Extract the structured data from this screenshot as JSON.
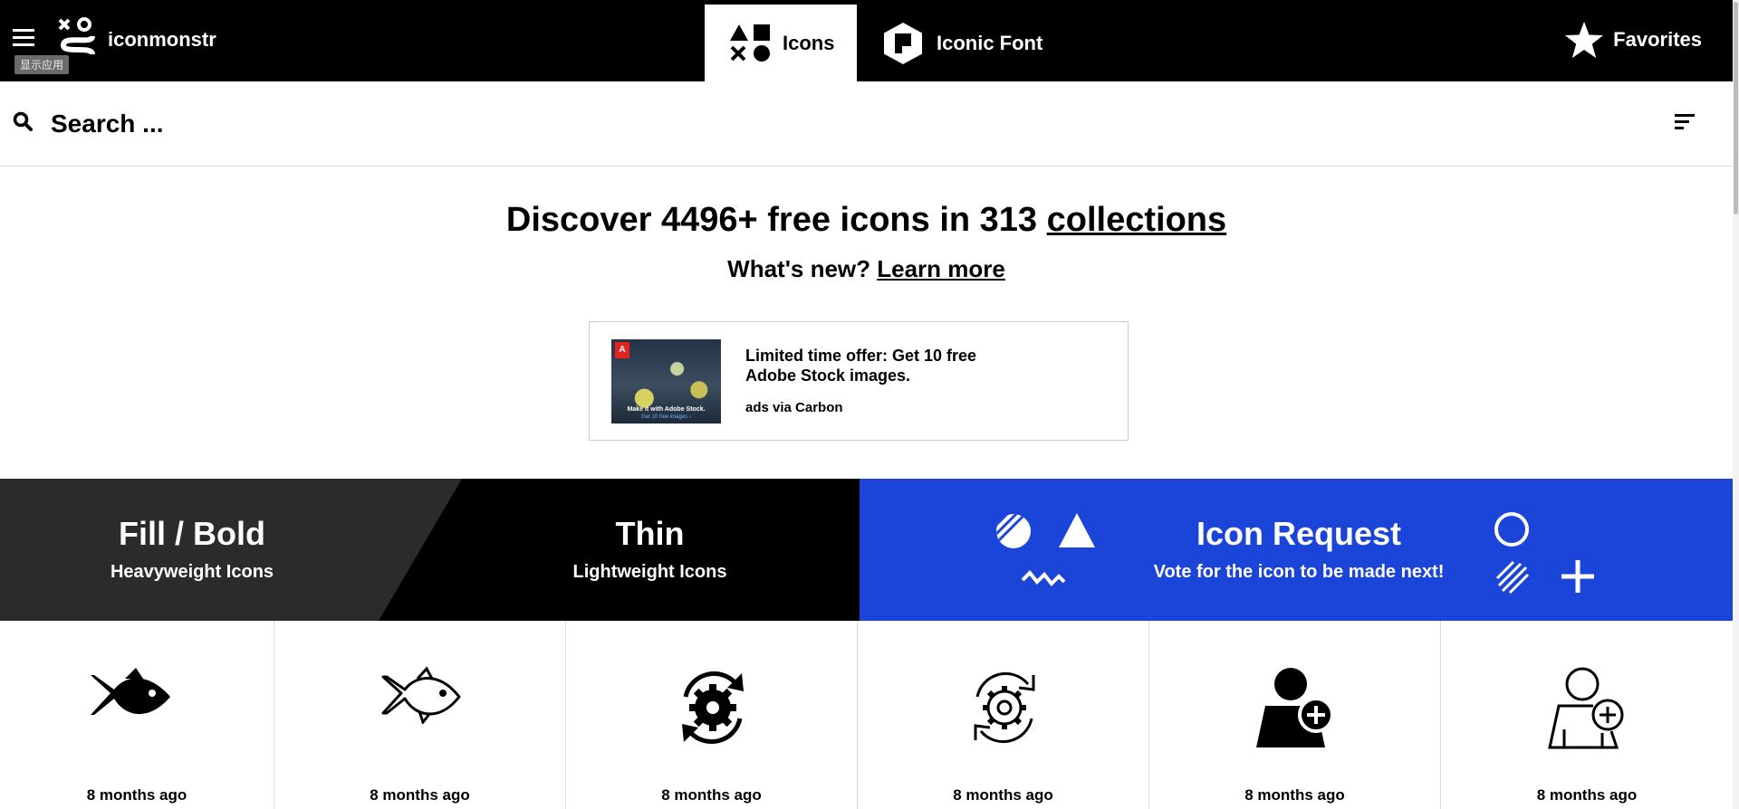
{
  "header": {
    "brand": "iconmonstr",
    "tooltip": "显示应用",
    "tabs": [
      {
        "label": "Icons",
        "active": true
      },
      {
        "label": "Iconic Font",
        "active": false
      }
    ],
    "favorites_label": "Favorites"
  },
  "search": {
    "placeholder": "Search ..."
  },
  "hero": {
    "title_prefix": "Discover 4496+ free icons in 313 ",
    "title_link": "collections",
    "sub_prefix": "What's new? ",
    "sub_link": "Learn more"
  },
  "ad": {
    "image_caption": "Make it with Adobe Stock.",
    "image_cta": "Get 10 free images ›",
    "text": "Limited time offer: Get 10 free Adobe Stock images.",
    "via": "ads via Carbon"
  },
  "banners": {
    "fill": {
      "title": "Fill / Bold",
      "subtitle": "Heavyweight Icons"
    },
    "thin": {
      "title": "Thin",
      "subtitle": "Lightweight Icons"
    },
    "request": {
      "title": "Icon Request",
      "subtitle": "Vote for the icon to be made next!"
    }
  },
  "icons": [
    {
      "icon": "fish-filled-icon",
      "date": "8 months ago"
    },
    {
      "icon": "fish-thin-icon",
      "date": "8 months ago"
    },
    {
      "icon": "gear-sync-filled-icon",
      "date": "8 months ago"
    },
    {
      "icon": "gear-sync-thin-icon",
      "date": "8 months ago"
    },
    {
      "icon": "user-add-filled-icon",
      "date": "8 months ago"
    },
    {
      "icon": "user-add-thin-icon",
      "date": "8 months ago"
    }
  ],
  "colors": {
    "topbar": "#000000",
    "fill_banner": "#2b2b2b",
    "request_banner": "#1a45d8"
  }
}
